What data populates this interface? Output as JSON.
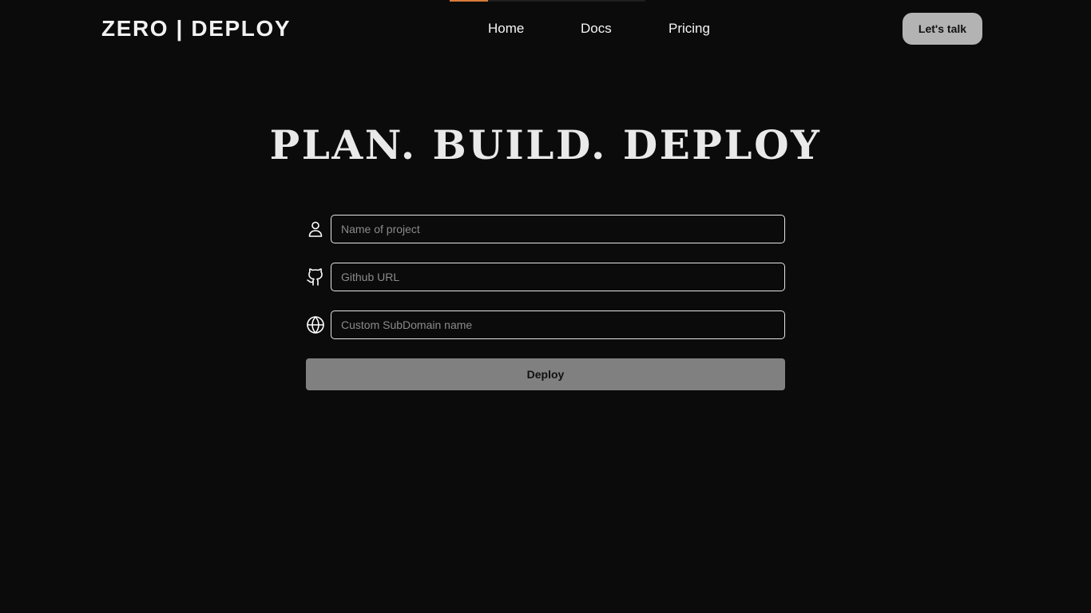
{
  "header": {
    "logo": "ZERO | DEPLOY",
    "nav": [
      {
        "label": "Home"
      },
      {
        "label": "Docs"
      },
      {
        "label": "Pricing"
      }
    ],
    "cta_label": "Let's talk"
  },
  "hero": {
    "title": "PLAN. BUILD. DEPLOY"
  },
  "form": {
    "fields": [
      {
        "icon": "user-icon",
        "placeholder": "Name of project",
        "value": ""
      },
      {
        "icon": "github-icon",
        "placeholder": "Github URL",
        "value": ""
      },
      {
        "icon": "globe-icon",
        "placeholder": "Custom SubDomain name",
        "value": ""
      }
    ],
    "submit_label": "Deploy"
  },
  "colors": {
    "background": "#0b0b0b",
    "accent": "#d87a3a",
    "cta_background": "#b3b3b3",
    "submit_background": "#808080"
  }
}
